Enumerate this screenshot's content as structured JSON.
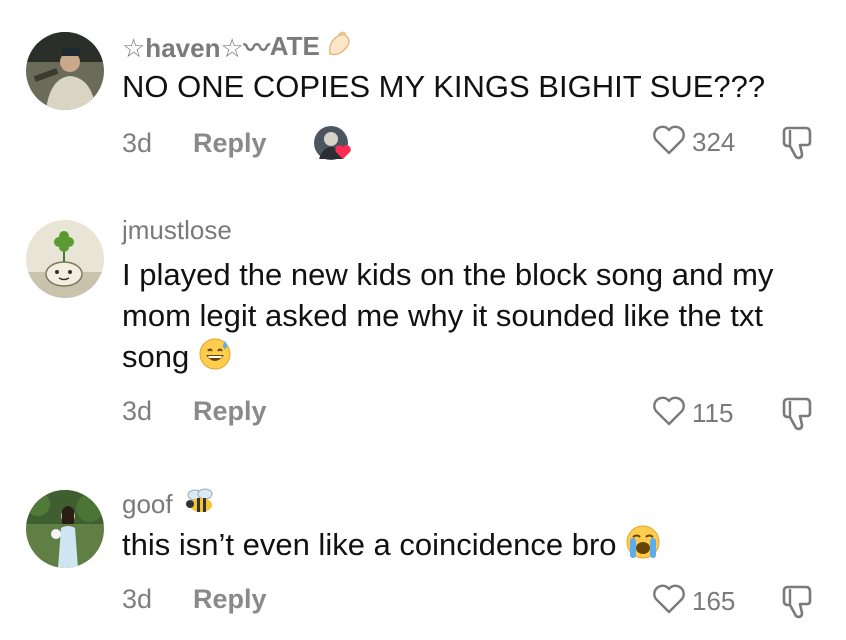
{
  "comments": [
    {
      "username_prefix": "☆haven☆〰",
      "username_suffix": "ATE",
      "text": "NO ONE COPIES MY KINGS BIGHIT SUE???",
      "age": "3d",
      "reply_label": "Reply",
      "likes": "324",
      "badge_icon": "hand-icon",
      "creator_liked": true
    },
    {
      "username": "jmustlose",
      "text": "I played the new kids on the block song and my mom legit asked me why it sounded like the txt song",
      "text_emoji": "grinning-sweat-emoji",
      "age": "3d",
      "reply_label": "Reply",
      "likes": "115"
    },
    {
      "username": "goof",
      "badge_icon": "bee-icon",
      "text": "this isn’t even like a coincidence bro",
      "text_emoji": "loudly-crying-emoji",
      "age": "3d",
      "reply_label": "Reply",
      "likes": "165"
    }
  ],
  "colors": {
    "text": "#111111",
    "muted": "#7a7a7a",
    "heart_badge": "#fe2c55"
  }
}
